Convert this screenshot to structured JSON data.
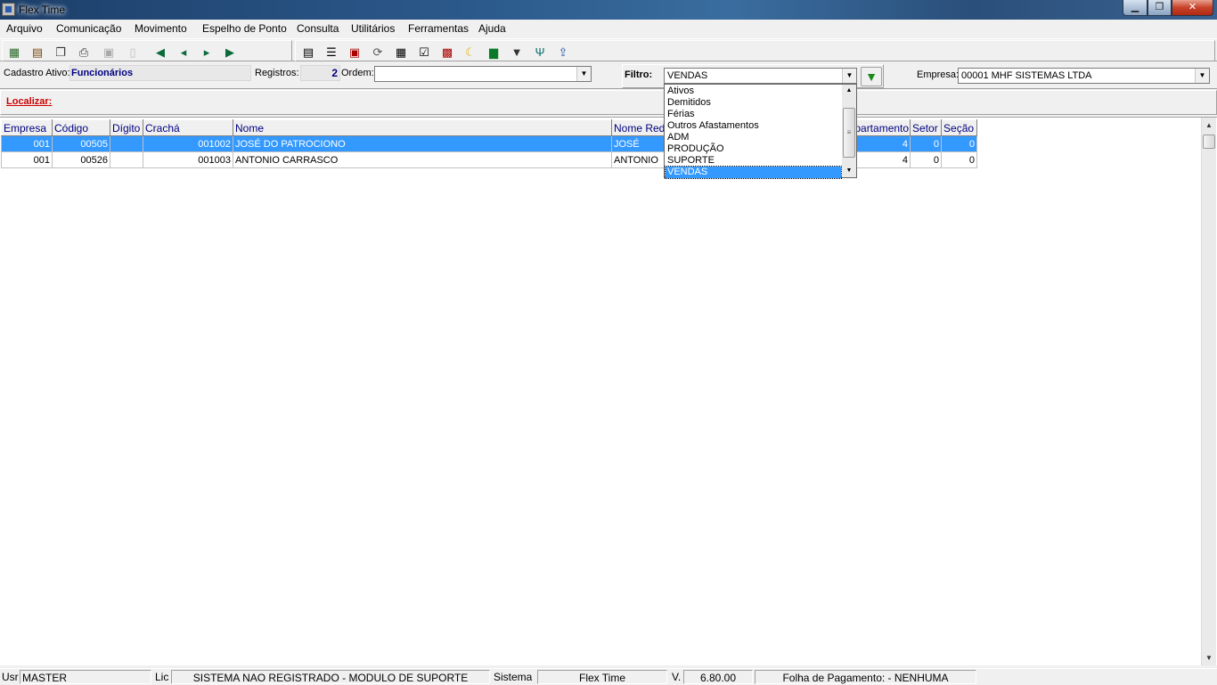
{
  "window": {
    "title": "Flex Time"
  },
  "menu": [
    "Arquivo",
    "Comunicação",
    "Movimento",
    "Espelho de Ponto",
    "Consulta",
    "Utilitários",
    "Ferramentas",
    "Ajuda"
  ],
  "toolbar": {
    "group1_icons": [
      "new-record-icon",
      "edit-record-icon",
      "copy-record-icon",
      "print-icon",
      "save-icon",
      "blank-document-icon"
    ],
    "nav_icons": [
      "first-record-icon",
      "previous-record-icon",
      "next-record-icon",
      "last-record-icon"
    ],
    "group2_icons": [
      "report-icon",
      "list-icon",
      "calendar-icon",
      "refresh-icon",
      "table-icon",
      "checklist-icon",
      "schedule-icon",
      "moon-icon",
      "excel-icon",
      "sign-icon",
      "filter-tool-icon",
      "export-icon"
    ]
  },
  "cadastro": {
    "label": "Cadastro Ativo:",
    "value": "Funcionários",
    "registros_label": "Registros:",
    "registros_value": "2",
    "ordem_label": "Ordem:",
    "ordem_value": ""
  },
  "filtro": {
    "label": "Filtro:",
    "value": "VENDAS",
    "options": [
      "Ativos",
      "Demitidos",
      "Férias",
      "Outros Afastamentos",
      "ADM",
      "PRODUÇÃO",
      "SUPORTE",
      "VENDAS"
    ],
    "selected_index": 7
  },
  "empresa": {
    "label": "Empresa:",
    "value": "00001 MHF SISTEMAS LTDA"
  },
  "localizar": {
    "label": "Localizar:"
  },
  "grid": {
    "columns": [
      "Empresa",
      "Código",
      "Dígito",
      "Crachá",
      "Nome",
      "Nome Red",
      "Departamento",
      "Setor",
      "Seção"
    ],
    "rows": [
      [
        "001",
        "00505",
        "",
        "001002",
        "JOSÉ DO PATROCIONO",
        "JOSÉ",
        "4",
        "0",
        "0"
      ],
      [
        "001",
        "00526",
        "",
        "001003",
        "ANTONIO CARRASCO",
        "ANTONIO",
        "4",
        "0",
        "0"
      ]
    ],
    "selected_row": 0
  },
  "status": {
    "usr_label": "Usr",
    "usr_value": "MASTER",
    "lic_label": "Lic",
    "lic_value": "SISTEMA NAO REGISTRADO - MODULO DE SUPORTE",
    "sistema_label": "Sistema",
    "sistema_value": "Flex Time",
    "versao_label": "V.",
    "versao_value": "6.80.00",
    "folha": "Folha de Pagamento:  - NENHUMA"
  },
  "colors": {
    "selection": "#3399ff",
    "header_text": "#000080",
    "accent_red": "#cc0000"
  }
}
